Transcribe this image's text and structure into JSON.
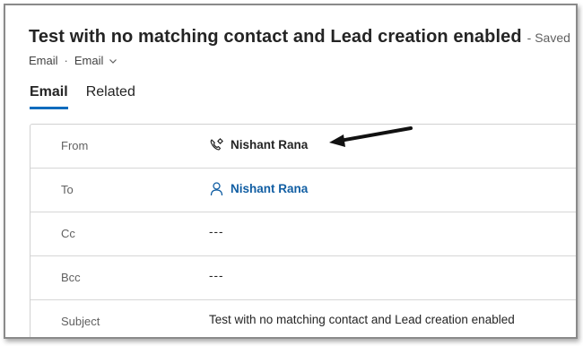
{
  "header": {
    "title": "Test with no matching contact and Lead creation enabled",
    "saved": "- Saved",
    "entity": "Email",
    "form": "Email"
  },
  "tabs": [
    {
      "label": "Email",
      "active": true
    },
    {
      "label": "Related",
      "active": false
    }
  ],
  "fields": {
    "from": {
      "label": "From",
      "value": "Nishant Rana",
      "icon": "queue-phone-gear-icon"
    },
    "to": {
      "label": "To",
      "value": "Nishant Rana",
      "icon": "person-icon"
    },
    "cc": {
      "label": "Cc",
      "value": "---"
    },
    "bcc": {
      "label": "Bcc",
      "value": "---"
    },
    "subject": {
      "label": "Subject",
      "value": "Test with no matching contact and Lead creation enabled"
    }
  },
  "colors": {
    "accent": "#0f6cbd",
    "link": "#115ea3"
  }
}
